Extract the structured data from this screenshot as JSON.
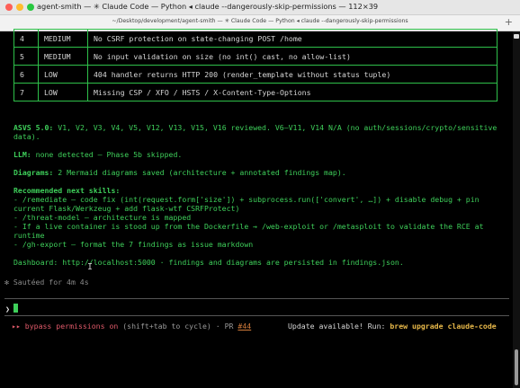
{
  "window": {
    "title": "agent-smith — ✳ Claude Code — Python ◂ claude --dangerously-skip-permissions — 112×39",
    "tab_title": "~/Desktop/development/agent-smith — ✳ Claude Code — Python ◂ claude --dangerously-skip-permissions",
    "new_tab": "+"
  },
  "findings_table": {
    "rows": [
      {
        "num": "4",
        "severity": "MEDIUM",
        "issue": "No CSRF protection on state-changing POST /home"
      },
      {
        "num": "5",
        "severity": "MEDIUM",
        "issue": "No input validation on size (no int() cast, no allow-list)"
      },
      {
        "num": "6",
        "severity": "LOW",
        "issue": "404 handler returns HTTP 200 (render_template without status tuple)"
      },
      {
        "num": "7",
        "severity": "LOW",
        "issue": "Missing CSP / XFO / HSTS / X-Content-Type-Options"
      }
    ]
  },
  "report": {
    "asvs_label": "ASVS 5.0:",
    "asvs_text_1": " V1, V2, V3, V4, V5, V12, V13, V15, V16 reviewed. V6–V11, V14 N/A (no auth/sessions/crypto/sensitive",
    "asvs_text_2": "data).",
    "llm_label": "LLM:",
    "llm_text": " none detected — Phase 5b skipped.",
    "diagrams_label": "Diagrams:",
    "diagrams_text": " 2 Mermaid diagrams saved (architecture + annotated findings map).",
    "next_steps_label": "Recommended next skills:",
    "steps": [
      "- /remediate — code fix (int(request.form['size']) + subprocess.run(['convert', …]) + disable debug + pin",
      "current Flask/Werkzeug + add flask-wtf CSRFProtect)",
      "- /threat-model — architecture is mapped",
      "- If a live container is stood up from the Dockerfile → /web-exploit or /metasploit to validate the RCE at",
      "runtime",
      "- /gh-export — format the 7 findings as issue markdown"
    ],
    "dashboard_text": "Dashboard: http://localhost:5000 · findings and diagrams are persisted in findings.json."
  },
  "spinner": {
    "text": "✻ Sautéed for 4m 4s"
  },
  "input": {
    "prompt_symbol": "❯"
  },
  "status": {
    "arrows": "▸▸",
    "bypass": " bypass permissions on",
    "hint": " (shift+tab to cycle) · PR ",
    "pr_number": "#44",
    "update_text": "Update available! Run: ",
    "update_cmd": "brew upgrade claude-code"
  },
  "colors": {
    "accent_green": "#3ecf5a",
    "table_border": "#2ec04a",
    "status_red": "#e05a6a",
    "update_yellow": "#e8b94a"
  }
}
